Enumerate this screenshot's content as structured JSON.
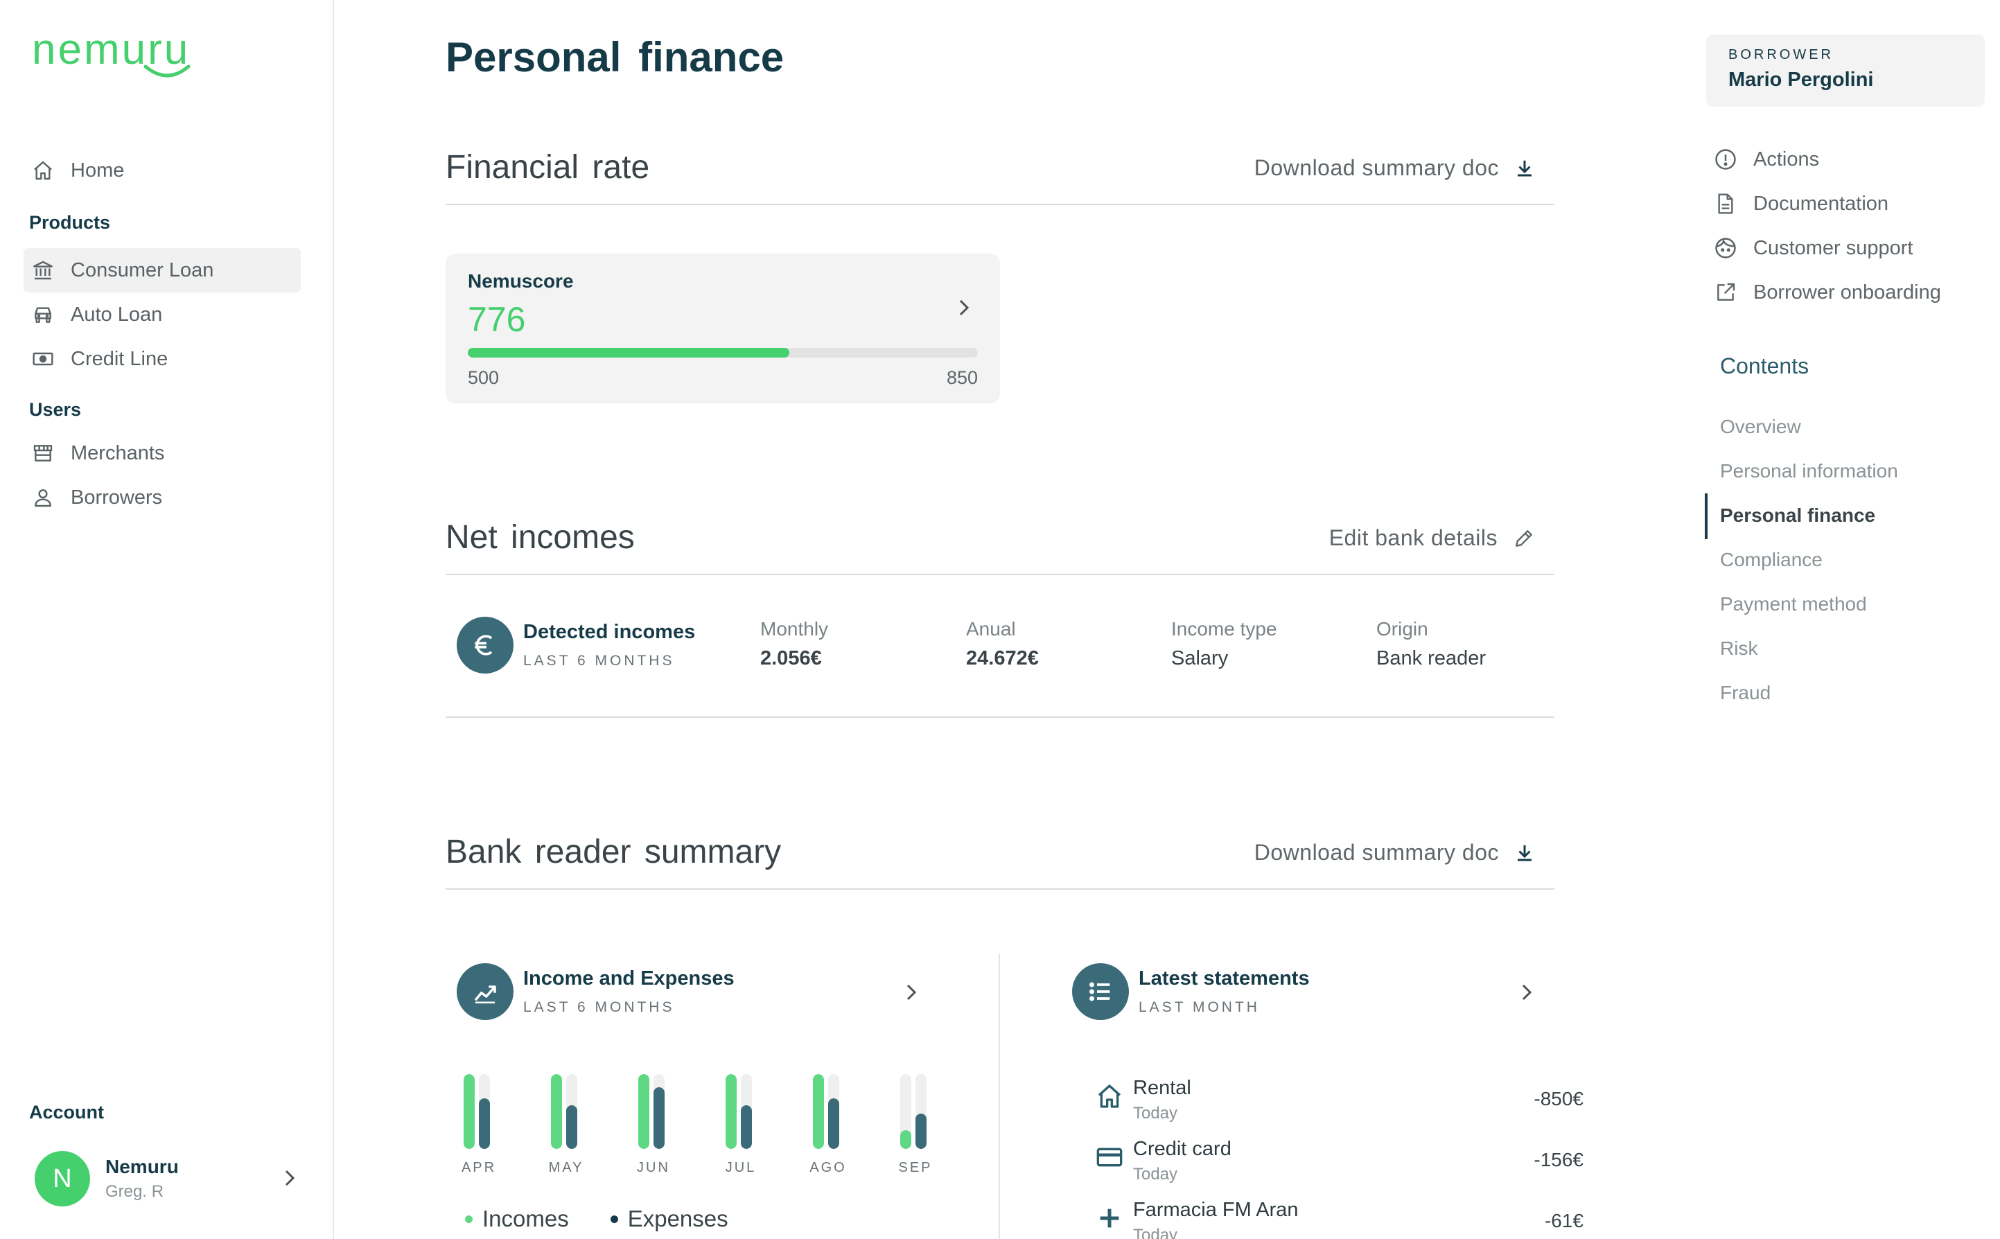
{
  "brand": {
    "name": "nemuru",
    "color": "#45cf6d"
  },
  "sidebar": {
    "home": {
      "label": "Home",
      "icon": "home-icon"
    },
    "products_heading": "Products",
    "products": [
      {
        "label": "Consumer Loan",
        "icon": "bank-icon",
        "active": true
      },
      {
        "label": "Auto Loan",
        "icon": "car-icon"
      },
      {
        "label": "Credit Line",
        "icon": "banknote-icon"
      }
    ],
    "users_heading": "Users",
    "users": [
      {
        "label": "Merchants",
        "icon": "store-icon"
      },
      {
        "label": "Borrowers",
        "icon": "user-icon"
      }
    ],
    "account": {
      "heading": "Account",
      "avatar_letter": "N",
      "name": "Nemuru",
      "sub": "Greg. R"
    }
  },
  "main": {
    "title": "Personal  finance",
    "financial_rate": {
      "title": "Financial  rate",
      "action": "Download summary doc",
      "score": {
        "label": "Nemuscore",
        "value": "776",
        "min": "500",
        "max": "850",
        "progress_fraction": 0.63
      }
    },
    "net_incomes": {
      "title": "Net incomes",
      "action": "Edit bank details",
      "detected": {
        "title": "Detected incomes",
        "sub": "LAST 6 MONTHS"
      },
      "columns": [
        {
          "label": "Monthly",
          "value": "2.056€",
          "bold": true
        },
        {
          "label": "Anual",
          "value": "24.672€",
          "bold": true
        },
        {
          "label": "Income type",
          "value": "Salary",
          "bold": false
        },
        {
          "label": "Origin",
          "value": "Bank reader",
          "bold": false
        }
      ]
    },
    "bank_reader": {
      "title": "Bank reader summary",
      "action": "Download summary doc",
      "income_expenses": {
        "title": "Income and Expenses",
        "sub": "LAST 6 MONTHS",
        "legend": {
          "incomes": "Incomes",
          "expenses": "Expenses"
        },
        "colors": {
          "incomes": "#5fd884",
          "expenses": "#3b6b79",
          "track": "#efefef"
        }
      },
      "statements": {
        "title": "Latest statements",
        "sub": "LAST MONTH",
        "items": [
          {
            "name": "Rental",
            "date": "Today",
            "amount": "-850€",
            "icon": "home-icon"
          },
          {
            "name": "Credit card",
            "date": "Today",
            "amount": "-156€",
            "icon": "credit-card-icon"
          },
          {
            "name": "Farmacia FM Aran",
            "date": "Today",
            "amount": "-61€",
            "icon": "plus-icon"
          }
        ]
      }
    }
  },
  "chart_data": {
    "type": "bar",
    "categories": [
      "APR",
      "MAY",
      "JUN",
      "JUL",
      "AGO",
      "SEP"
    ],
    "series": [
      {
        "name": "Incomes",
        "values": [
          1.0,
          1.0,
          1.0,
          1.0,
          1.0,
          0.25
        ]
      },
      {
        "name": "Expenses",
        "values": [
          0.68,
          0.58,
          0.82,
          0.58,
          0.68,
          0.47
        ]
      }
    ],
    "ylim": [
      0,
      1
    ]
  },
  "right_panel": {
    "borrower": {
      "label": "BORROWER",
      "name": "Mario Pergolini"
    },
    "links": [
      {
        "label": "Actions",
        "icon": "info-circle-icon"
      },
      {
        "label": "Documentation",
        "icon": "document-icon"
      },
      {
        "label": "Customer support",
        "icon": "support-face-icon"
      },
      {
        "label": "Borrower onboarding",
        "icon": "external-link-icon"
      }
    ],
    "contents_heading": "Contents",
    "contents": [
      {
        "label": "Overview"
      },
      {
        "label": "Personal information"
      },
      {
        "label": "Personal finance",
        "active": true
      },
      {
        "label": "Compliance"
      },
      {
        "label": "Payment method"
      },
      {
        "label": "Risk"
      },
      {
        "label": "Fraud"
      }
    ]
  }
}
